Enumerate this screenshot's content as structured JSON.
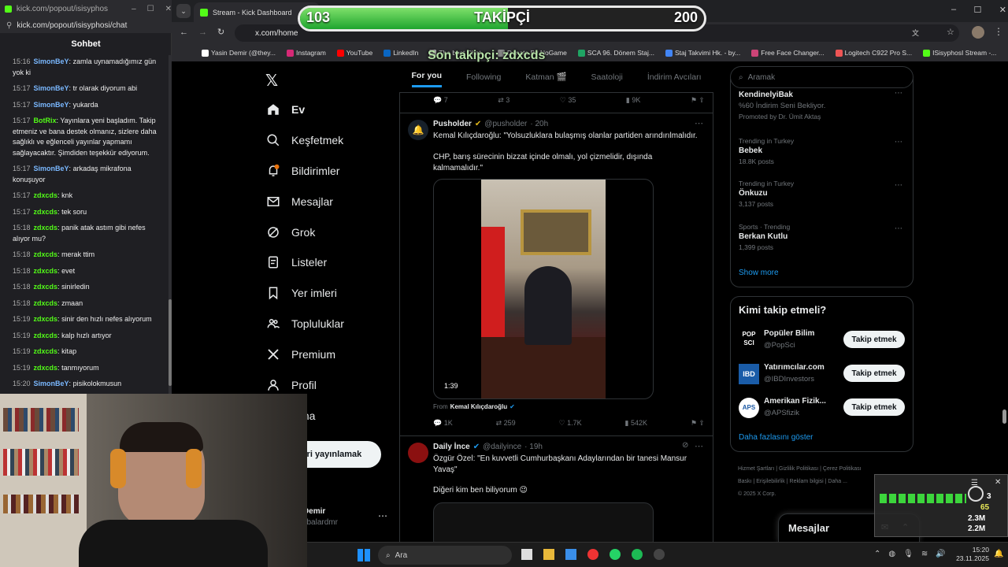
{
  "chat": {
    "tab_title": "kick.com/popout/isisyphosi...",
    "url": "kick.com/popout/isisyphosi/chat",
    "header": "Sohbet",
    "messages": [
      {
        "ts": "15:16",
        "user": "SimonBeY",
        "color": "#7ab8ff",
        "text": "zamla uynamadığımız gün yok ki"
      },
      {
        "ts": "15:17",
        "user": "SimonBeY",
        "color": "#7ab8ff",
        "text": "tr olarak diyorum abi"
      },
      {
        "ts": "15:17",
        "user": "SimonBeY",
        "color": "#7ab8ff",
        "text": "yukarda"
      },
      {
        "ts": "15:17",
        "user": "BotRix",
        "color": "#53fc18",
        "text": "Yayınlara yeni başladım. Takip etmeniz ve bana destek olmanız, sizlere daha sağlıklı ve eğlenceli yayınlar yapmamı sağlayacaktır. Şimdiden teşekkür ediyorum."
      },
      {
        "ts": "15:17",
        "user": "SimonBeY",
        "color": "#7ab8ff",
        "text": "arkadaş mikrafona konuşuyor"
      },
      {
        "ts": "15:17",
        "user": "zdxcds",
        "color": "#53fc18",
        "text": "knk"
      },
      {
        "ts": "15:17",
        "user": "zdxcds",
        "color": "#53fc18",
        "text": "tek soru"
      },
      {
        "ts": "15:18",
        "user": "zdxcds",
        "color": "#53fc18",
        "text": "panik atak astım gibi nefes alıyor mu?"
      },
      {
        "ts": "15:18",
        "user": "zdxcds",
        "color": "#53fc18",
        "text": "merak ttim"
      },
      {
        "ts": "15:18",
        "user": "zdxcds",
        "color": "#53fc18",
        "text": "evet"
      },
      {
        "ts": "15:18",
        "user": "zdxcds",
        "color": "#53fc18",
        "text": "sinirledin"
      },
      {
        "ts": "15:18",
        "user": "zdxcds",
        "color": "#53fc18",
        "text": "zmaan"
      },
      {
        "ts": "15:19",
        "user": "zdxcds",
        "color": "#53fc18",
        "text": "sinir den hızlı nefes alıyorum"
      },
      {
        "ts": "15:19",
        "user": "zdxcds",
        "color": "#53fc18",
        "text": "kalp hızlı artıyor"
      },
      {
        "ts": "15:19",
        "user": "zdxcds",
        "color": "#53fc18",
        "text": "kitap"
      },
      {
        "ts": "15:19",
        "user": "zdxcds",
        "color": "#53fc18",
        "text": "tanmıyorum"
      },
      {
        "ts": "15:20",
        "user": "SimonBeY",
        "color": "#7ab8ff",
        "text": "pisikolokmusun"
      }
    ]
  },
  "browser": {
    "tab_title": "Stream - Kick Dashboard",
    "url": "x.com/home",
    "bookmarks": [
      "Yasin Demir (@they...",
      "Instagram",
      "YouTube",
      "LinkedIn",
      "The best Chat...",
      "Donate By NoGame",
      "SCA 96. Dönem Staj...",
      "Staj Takvimi Hk. - by...",
      "Free Face Changer...",
      "Logitech C922 Pro S...",
      "ISisyphosI Stream -..."
    ]
  },
  "overlay": {
    "follower_current": "103",
    "follower_label": "TAKİPÇİ",
    "follower_goal": "200",
    "follower_progress": 0.515,
    "last_follower": "Son takipçi: zdxcds"
  },
  "nav": {
    "items": [
      "Ev",
      "Keşfetmek",
      "Bildirimler",
      "Mesajlar",
      "Grok",
      "Listeler",
      "Yer imleri",
      "Topluluklar",
      "Premium",
      "Profil",
      "Daha"
    ],
    "post_button": "Gönderi yayınlamak",
    "profile_name": "Yasin Demir",
    "profile_handle": "@yasinbalardmr"
  },
  "timeline": {
    "tabs": [
      "For you",
      "Following",
      "Katman 🎬",
      "Saatoloji",
      "İndirim Avcıları"
    ],
    "top_actions": {
      "replies": "7",
      "reposts": "3",
      "likes": "35",
      "views": "9K"
    },
    "tweet1": {
      "name": "Pusholder",
      "handle": "@pusholder",
      "time": "· 20h",
      "text1": "Kemal Kılıçdaroğlu: \"Yolsuzluklara bulaşmış olanlar partiden arındırılmalıdır.",
      "text2": "CHP, barış sürecinin bizzat içinde olmalı, yol çizmelidir, dışında kalmamalıdır.\"",
      "video_time": "1:39",
      "from_label": "From",
      "from_name": "Kemal Kılıçdaroğlu",
      "replies": "1K",
      "reposts": "259",
      "likes": "1.7K",
      "views": "542K"
    },
    "tweet2": {
      "name": "Daily İnce",
      "handle": "@dailyince",
      "time": "· 19h",
      "text1": "Özgür Özel: \"En kuvvetli Cumhurbaşkanı Adaylarından bir tanesi Mansur Yavaş\"",
      "text2": "Diğeri kim ben biliyorum 😉"
    }
  },
  "right": {
    "search_placeholder": "Aramak",
    "promo": {
      "name": "KendinelyiBak",
      "text": "%60 İndirim Seni Bekliyor.",
      "promoted": "Promoted by Dr. Ümit Aktaş"
    },
    "trends": [
      {
        "meta": "Trending in Turkey",
        "name": "Bebek",
        "posts": "18.8K posts"
      },
      {
        "meta": "Trending in Turkey",
        "name": "Önkuzu",
        "posts": "3,137 posts"
      },
      {
        "meta": "Sports · Trending",
        "name": "Berkan Kutlu",
        "posts": "1,399 posts"
      }
    ],
    "show_more": "Show more",
    "who_title": "Kimi takip etmeli?",
    "who": [
      {
        "name": "Popüler Bilim",
        "handle": "@PopSci",
        "logo": "POP SCI"
      },
      {
        "name": "Yatırımcılar.com",
        "handle": "@IBDInvestors",
        "logo": "IBD"
      },
      {
        "name": "Amerikan Fizik...",
        "handle": "@APSfizik",
        "logo": "APS"
      }
    ],
    "follow_label": "Takip etmek",
    "show_more2": "Daha fazlasını göster",
    "footer": [
      "Hizmet Şartları",
      "Gizlilik Politikası",
      "Çerez Politikası",
      "Baskı",
      "Erişilebilirlik",
      "Reklam bilgisi",
      "Daha ...",
      "© 2025 X Corp."
    ],
    "messages_label": "Mesajlar"
  },
  "widget": {
    "v1": "3",
    "v2": "65",
    "v3": "2.3M",
    "v4": "2.2M"
  },
  "taskbar": {
    "search": "Ara",
    "time": "15:20",
    "date": "23.11.2025"
  }
}
